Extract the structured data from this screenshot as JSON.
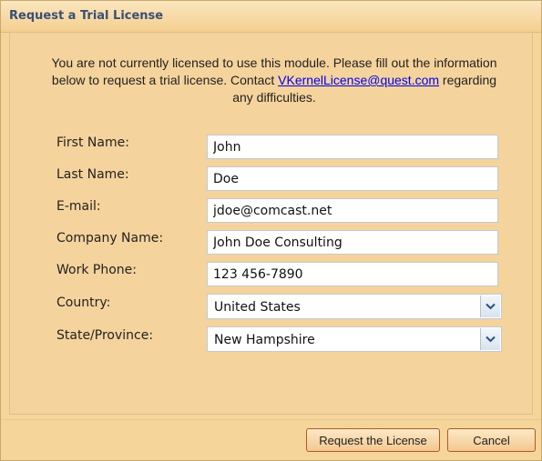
{
  "dialog": {
    "title": "Request a Trial License",
    "intro_text": "You are not currently licensed to use this module. Please fill out the information below to request a trial license. Contact",
    "intro_email": "VKernelLicense@quest.com",
    "intro_suffix": "regarding any difficulties."
  },
  "form": {
    "first_name": {
      "label": "First Name:",
      "value": "John"
    },
    "last_name": {
      "label": "Last Name:",
      "value": "Doe"
    },
    "email": {
      "label": "E-mail:",
      "value": "jdoe@comcast.net"
    },
    "company_name": {
      "label": "Company Name:",
      "value": "John Doe Consulting"
    },
    "work_phone": {
      "label": "Work Phone:",
      "value": "123 456-7890"
    },
    "country": {
      "label": "Country:",
      "value": "United States"
    },
    "state": {
      "label": "State/Province:",
      "value": "New Hampshire"
    }
  },
  "buttons": {
    "request": "Request the License",
    "cancel": "Cancel"
  },
  "colors": {
    "background": "#f6d59b",
    "title_text": "#3b4f74",
    "button_border": "#b25a1f"
  },
  "icons": {
    "dropdown": "chevron-down-icon"
  }
}
